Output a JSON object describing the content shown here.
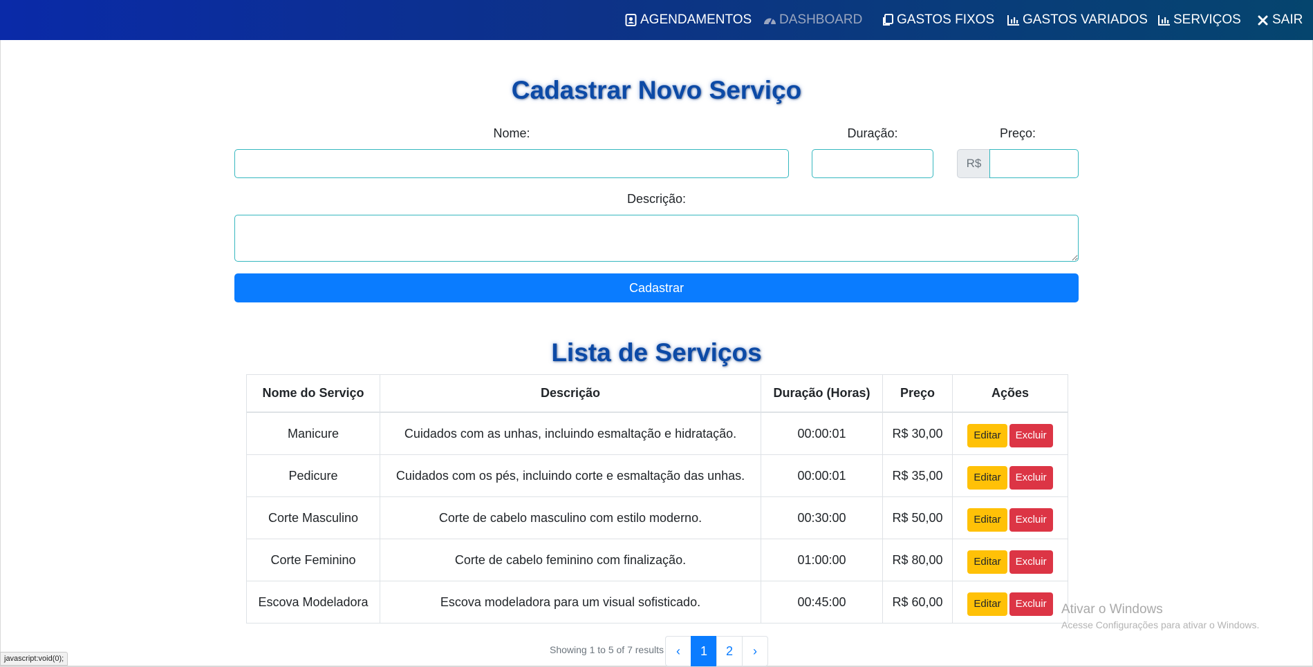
{
  "nav": {
    "items": [
      {
        "label": "AGENDAMENTOS",
        "icon": "address-card-icon"
      },
      {
        "label": "DASHBOARD",
        "icon": "gauge-icon"
      },
      {
        "label": "GASTOS FIXOS",
        "icon": "copy-icon"
      },
      {
        "label": "GASTOS VARIADOS",
        "icon": "bar-chart-icon"
      },
      {
        "label": "SERVIÇOS",
        "icon": "bar-chart-icon"
      },
      {
        "label": "SAIR",
        "icon": "close-icon"
      }
    ],
    "gradient": [
      "#0a2aa8",
      "#05456e"
    ],
    "muted_color": "#9aa6bf"
  },
  "form": {
    "title": "Cadastrar Novo Serviço",
    "nome_label": "Nome:",
    "duracao_label": "Duração:",
    "preco_label": "Preço:",
    "preco_prefix": "R$",
    "descricao_label": "Descrição:",
    "nome_value": "",
    "duracao_value": "",
    "preco_value": "",
    "descricao_value": "",
    "submit_label": "Cadastrar"
  },
  "list": {
    "title": "Lista de Serviços",
    "columns": [
      "Nome do Serviço",
      "Descrição",
      "Duração (Horas)",
      "Preço",
      "Ações"
    ],
    "rows": [
      {
        "nome": "Manicure",
        "descricao": "Cuidados com as unhas, incluindo esmaltação e hidratação.",
        "duracao": "00:00:01",
        "preco": "R$ 30,00"
      },
      {
        "nome": "Pedicure",
        "descricao": "Cuidados com os pés, incluindo corte e esmaltação das unhas.",
        "duracao": "00:00:01",
        "preco": "R$ 35,00"
      },
      {
        "nome": "Corte Masculino",
        "descricao": "Corte de cabelo masculino com estilo moderno.",
        "duracao": "00:30:00",
        "preco": "R$ 50,00"
      },
      {
        "nome": "Corte Feminino",
        "descricao": "Corte de cabelo feminino com finalização.",
        "duracao": "01:00:00",
        "preco": "R$ 80,00"
      },
      {
        "nome": "Escova Modeladora",
        "descricao": "Escova modeladora para um visual sofisticado.",
        "duracao": "00:45:00",
        "preco": "R$ 60,00"
      }
    ],
    "edit_label": "Editar",
    "delete_label": "Excluir",
    "colors": {
      "edit": "#ffc107",
      "delete": "#dc3545",
      "primary": "#0a7cff"
    }
  },
  "pagination": {
    "summary": "Showing 1 to 5 of 7 results",
    "prev": "‹",
    "pages": [
      "1",
      "2"
    ],
    "next": "›",
    "active_page": "1"
  },
  "watermark": {
    "line1": "Ativar o Windows",
    "line2": "Acesse Configurações para ativar o Windows."
  },
  "status_bar": {
    "url": "javascript:void(0);"
  }
}
